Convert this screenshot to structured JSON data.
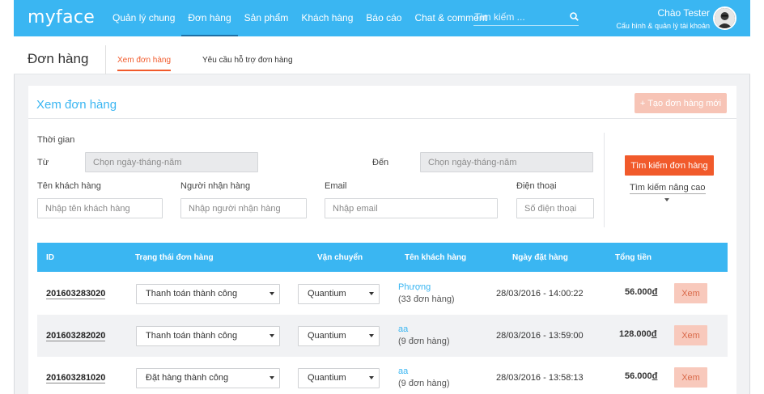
{
  "header": {
    "logo": "myface",
    "nav": [
      "Quản lý chung",
      "Đơn hàng",
      "Sản phẩm",
      "Khách hàng",
      "Báo cáo",
      "Chat & comment"
    ],
    "active_nav": "Đơn hàng",
    "search_placeholder": "Tìm kiếm ...",
    "greeting": "Chào Tester",
    "account_link": "Cấu hình & quản lý tài khoản"
  },
  "page": {
    "title": "Đơn hàng",
    "tabs": [
      "Xem đơn hàng",
      "Yêu cầu hỗ trợ đơn hàng"
    ],
    "active_tab": "Xem đơn hàng"
  },
  "card": {
    "title": "Xem đơn hàng",
    "new_order_button": "+ Tạo đơn hàng mới"
  },
  "filters": {
    "time_label": "Thời gian",
    "from_label": "Từ",
    "to_label": "Đến",
    "from_placeholder": "Chọn ngày-tháng-năm",
    "to_placeholder": "Chọn ngày-tháng-năm",
    "customer_label": "Tên khách hàng",
    "customer_placeholder": "Nhập tên khách hàng",
    "receiver_label": "Người nhận hàng",
    "receiver_placeholder": "Nhập người nhận hàng",
    "email_label": "Email",
    "email_placeholder": "Nhập email",
    "phone_label": "Điện thoại",
    "phone_placeholder": "Số điện thoại",
    "search_button": "Tìm kiếm đơn hàng",
    "advanced_link": "Tìm kiếm nâng cao"
  },
  "table": {
    "columns": [
      "ID",
      "Trạng thái đơn hàng",
      "Vận chuyển",
      "Tên khách hàng",
      "Ngày đặt hàng",
      "Tổng tiền"
    ],
    "view_label": "Xem",
    "currency": "đ",
    "rows": [
      {
        "id": "201603283020",
        "status": "Thanh toán thành công",
        "shipping": "Quantium",
        "customer": "Phượng",
        "orders": "(33 đơn hàng)",
        "date": "28/03/2016 - 14:00:22",
        "total": "56.000"
      },
      {
        "id": "201603282020",
        "status": "Thanh toán thành công",
        "shipping": "Quantium",
        "customer": "aa",
        "orders": "(9 đơn hàng)",
        "date": "28/03/2016 - 13:59:00",
        "total": "128.000"
      },
      {
        "id": "201603281020",
        "status": "Đặt hàng thành công",
        "shipping": "Quantium",
        "customer": "aa",
        "orders": "(9 đơn hàng)",
        "date": "28/03/2016 - 13:58:13",
        "total": "56.000"
      }
    ]
  }
}
